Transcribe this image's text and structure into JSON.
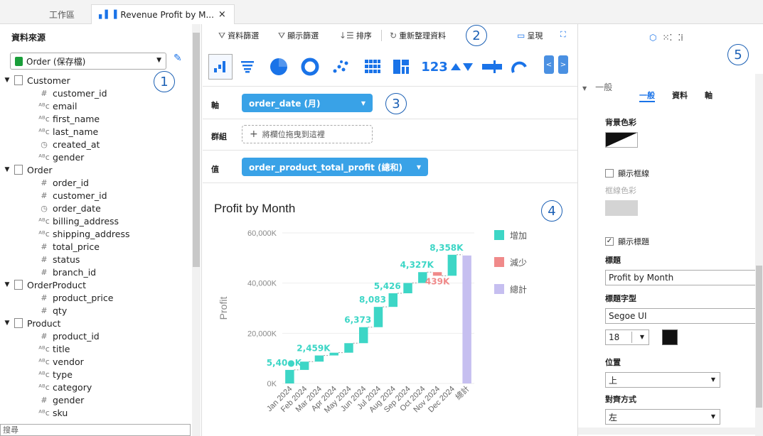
{
  "tabs": {
    "workspace": "工作區",
    "active": "Revenue Profit by M...",
    "close": "×"
  },
  "left": {
    "title": "資料來源",
    "source": "Order (保存檔)",
    "badge": "1",
    "search_placeholder": "搜尋",
    "tables": [
      {
        "name": "Customer",
        "fields": [
          {
            "name": "customer_id",
            "type": "#"
          },
          {
            "name": "email",
            "type": "ABC"
          },
          {
            "name": "first_name",
            "type": "ABC"
          },
          {
            "name": "last_name",
            "type": "ABC"
          },
          {
            "name": "created_at",
            "type": "clock"
          },
          {
            "name": "gender",
            "type": "ABC"
          }
        ]
      },
      {
        "name": "Order",
        "fields": [
          {
            "name": "order_id",
            "type": "#"
          },
          {
            "name": "customer_id",
            "type": "#"
          },
          {
            "name": "order_date",
            "type": "clock"
          },
          {
            "name": "billing_address",
            "type": "ABC"
          },
          {
            "name": "shipping_address",
            "type": "ABC"
          },
          {
            "name": "total_price",
            "type": "#"
          },
          {
            "name": "status",
            "type": "#"
          },
          {
            "name": "branch_id",
            "type": "#"
          }
        ]
      },
      {
        "name": "OrderProduct",
        "fields": [
          {
            "name": "product_price",
            "type": "#"
          },
          {
            "name": "qty",
            "type": "#"
          }
        ]
      },
      {
        "name": "Product",
        "fields": [
          {
            "name": "product_id",
            "type": "#"
          },
          {
            "name": "title",
            "type": "ABC"
          },
          {
            "name": "vendor",
            "type": "ABC"
          },
          {
            "name": "type",
            "type": "ABC"
          },
          {
            "name": "category",
            "type": "ABC"
          },
          {
            "name": "gender",
            "type": "#"
          },
          {
            "name": "sku",
            "type": "ABC"
          }
        ]
      }
    ]
  },
  "toolbar": {
    "data_filter": "資料篩選",
    "display_filter": "顯示篩選",
    "sort": "排序",
    "refresh": "重新整理資料",
    "present": "呈現",
    "badge": "2"
  },
  "fields": {
    "axis_label": "軸",
    "axis_value": "order_date (月)",
    "group_label": "群組",
    "group_drop": "將欄位拖曳到這裡",
    "value_label": "值",
    "value_value": "order_product_total_profit (總和)",
    "badge": "3"
  },
  "chart_badge": "4",
  "right": {
    "badge": "5",
    "tab_general": "一般",
    "tab_data": "資料",
    "tab_axis": "軸",
    "section": "一般",
    "bg_color": "背景色彩",
    "show_border": "顯示框線",
    "border_color": "框線色彩",
    "show_title": "顯示標題",
    "title_label": "標題",
    "title_value": "Profit by Month",
    "font_label": "標題字型",
    "font_value": "Segoe UI",
    "size_value": "18",
    "position_label": "位置",
    "position_value": "上",
    "align_label": "對齊方式",
    "align_value": "左"
  },
  "colors": {
    "increase": "#3dd6c6",
    "decrease": "#f08a8a",
    "total": "#c6bff0",
    "accent": "#1a73e8"
  },
  "chart_data": {
    "type": "waterfall",
    "title": "Profit by Month",
    "ylabel": "Profit",
    "ylim": [
      0,
      60000
    ],
    "yticks": [
      "0K",
      "20,000K",
      "40,000K",
      "60,000K"
    ],
    "categories": [
      "Jan 2024",
      "Feb 2024",
      "Mar 2024",
      "Apr 2024",
      "May 2024",
      "Jun 2024",
      "Jul 2024",
      "Aug 2024",
      "Sep 2024",
      "Oct 2024",
      "Nov 2024",
      "Dec 2024",
      "總計"
    ],
    "values": [
      5400,
      3300,
      2459,
      1100,
      3800,
      6373,
      8083,
      5426,
      4100,
      4327,
      -1439,
      8358,
      51000
    ],
    "data_labels": [
      "5,40●K",
      "",
      "2,459K",
      "",
      "",
      "6,373",
      "8,083",
      "5,426",
      "",
      "4,327K",
      "439K",
      "8,358K",
      ""
    ],
    "legend": [
      "增加",
      "減少",
      "總計"
    ],
    "legend_position": "right"
  }
}
